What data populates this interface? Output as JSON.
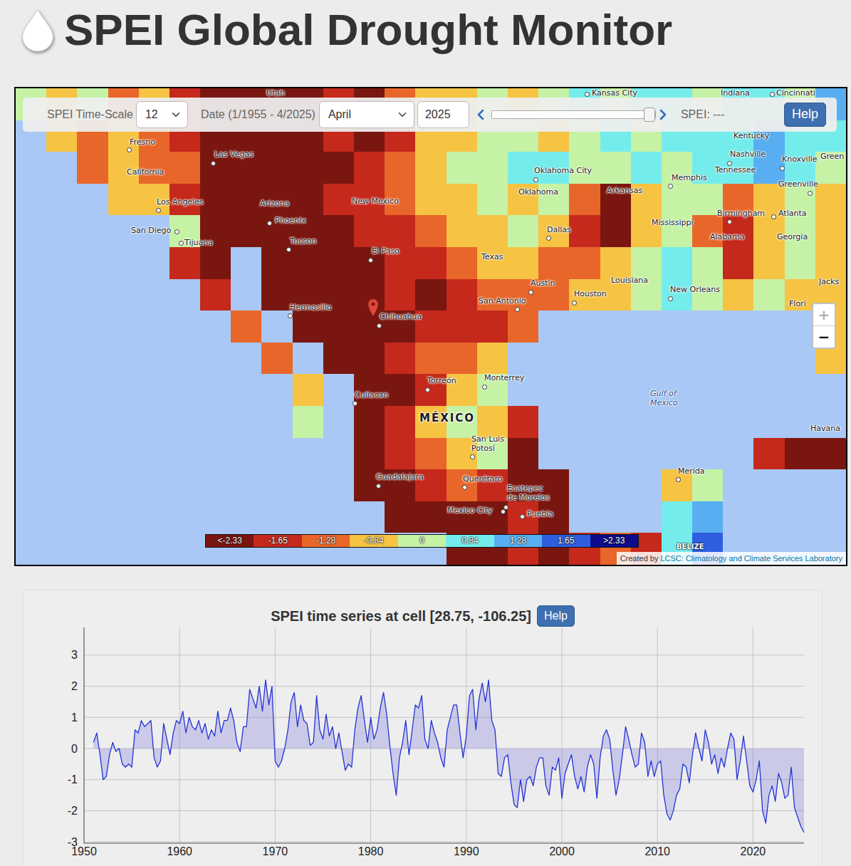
{
  "header": {
    "title": "SPEI Global Drought Monitor"
  },
  "controls": {
    "timescale_label": "SPEI Time-Scale",
    "timescale_value": "12",
    "date_label": "Date (1/1955 - 4/2025)",
    "month_value": "April",
    "year_value": "2025",
    "slider": {
      "level": 1
    },
    "spei_reading": "SPEI: ---",
    "help": "Help"
  },
  "map": {
    "grid": [
      [
        4,
        3,
        4,
        2,
        3,
        1,
        0,
        0,
        0,
        0,
        1,
        0,
        2,
        3,
        3,
        4,
        3,
        4,
        5,
        4,
        5,
        5,
        4,
        5,
        5,
        4,
        6
      ],
      [
        -1,
        3,
        2,
        3,
        2,
        1,
        0,
        0,
        0,
        0,
        1,
        0,
        1,
        3,
        3,
        4,
        4,
        3,
        4,
        5,
        4,
        5,
        5,
        5,
        6,
        5,
        5
      ],
      [
        -1,
        -1,
        2,
        3,
        2,
        2,
        0,
        0,
        0,
        0,
        0,
        1,
        2,
        3,
        4,
        4,
        5,
        5,
        4,
        4,
        5,
        4,
        5,
        5,
        6,
        5,
        4
      ],
      [
        -1,
        -1,
        -1,
        3,
        3,
        1,
        0,
        0,
        0,
        0,
        1,
        1,
        2,
        3,
        3,
        4,
        3,
        4,
        2,
        0,
        3,
        4,
        4,
        2,
        3,
        4,
        3
      ],
      [
        -1,
        -1,
        -1,
        -1,
        -1,
        4,
        0,
        0,
        0,
        0,
        0,
        1,
        1,
        2,
        3,
        3,
        4,
        3,
        1,
        0,
        3,
        4,
        2,
        1,
        3,
        4,
        3
      ],
      [
        -1,
        -1,
        -1,
        -1,
        -1,
        1,
        0,
        -1,
        0,
        0,
        0,
        0,
        1,
        1,
        2,
        3,
        3,
        2,
        2,
        3,
        4,
        5,
        4,
        1,
        3,
        4,
        3
      ],
      [
        -1,
        -1,
        -1,
        -1,
        -1,
        -1,
        1,
        -1,
        0,
        0,
        0,
        0,
        1,
        0,
        1,
        2,
        2,
        2,
        3,
        3,
        4,
        5,
        4,
        3,
        4,
        3,
        3
      ],
      [
        -1,
        -1,
        -1,
        -1,
        -1,
        -1,
        -1,
        2,
        -1,
        0,
        0,
        0,
        0,
        1,
        1,
        1,
        2,
        -1,
        -1,
        -1,
        -1,
        -1,
        -1,
        -1,
        -1,
        -1,
        3
      ],
      [
        -1,
        -1,
        -1,
        -1,
        -1,
        -1,
        -1,
        -1,
        2,
        -1,
        0,
        0,
        1,
        2,
        2,
        3,
        -1,
        -1,
        -1,
        -1,
        -1,
        -1,
        -1,
        -1,
        -1,
        -1,
        3
      ],
      [
        -1,
        -1,
        -1,
        -1,
        -1,
        -1,
        -1,
        -1,
        -1,
        3,
        -1,
        0,
        0,
        1,
        3,
        4,
        -1,
        -1,
        -1,
        -1,
        -1,
        -1,
        -1,
        -1,
        -1,
        -1,
        -1
      ],
      [
        -1,
        -1,
        -1,
        -1,
        -1,
        -1,
        -1,
        -1,
        -1,
        4,
        -1,
        0,
        1,
        3,
        4,
        3,
        1,
        -1,
        -1,
        -1,
        -1,
        -1,
        -1,
        -1,
        -1,
        -1,
        -1
      ],
      [
        -1,
        -1,
        -1,
        -1,
        -1,
        -1,
        -1,
        -1,
        -1,
        -1,
        -1,
        0,
        1,
        2,
        3,
        4,
        0,
        -1,
        -1,
        -1,
        -1,
        -1,
        -1,
        -1,
        1,
        0,
        0
      ],
      [
        -1,
        -1,
        -1,
        -1,
        -1,
        -1,
        -1,
        -1,
        -1,
        -1,
        -1,
        0,
        0,
        1,
        2,
        1,
        0,
        0,
        -1,
        -1,
        -1,
        3,
        4,
        -1,
        -1,
        -1,
        -1
      ],
      [
        -1,
        -1,
        -1,
        -1,
        -1,
        -1,
        -1,
        -1,
        -1,
        -1,
        -1,
        -1,
        0,
        0,
        0,
        0,
        1,
        0,
        -1,
        -1,
        -1,
        5,
        6,
        -1,
        -1,
        -1,
        -1
      ],
      [
        -1,
        -1,
        -1,
        -1,
        -1,
        -1,
        -1,
        -1,
        -1,
        -1,
        -1,
        -1,
        -1,
        -1,
        0,
        0,
        1,
        0,
        1,
        2,
        1,
        5,
        7,
        -1,
        -1,
        -1,
        -1
      ]
    ],
    "labels": [
      {
        "text": "Utah",
        "kind": "region"
      },
      {
        "text": "Kansas City",
        "kind": "city"
      },
      {
        "text": "Indiana",
        "kind": "region"
      },
      {
        "text": "Cincinnati",
        "kind": "city"
      },
      {
        "text": "Kentucky",
        "kind": "region"
      },
      {
        "text": "Fresno",
        "kind": "city"
      },
      {
        "text": "Las Vegas",
        "kind": "city"
      },
      {
        "text": "California",
        "kind": "region"
      },
      {
        "text": "Los Angeles",
        "kind": "city"
      },
      {
        "text": "San Diego",
        "kind": "city"
      },
      {
        "text": "Tijuana",
        "kind": "city"
      },
      {
        "text": "Arizona",
        "kind": "region"
      },
      {
        "text": "Phoenix",
        "kind": "city"
      },
      {
        "text": "Tucson",
        "kind": "city"
      },
      {
        "text": "New Mexico",
        "kind": "region"
      },
      {
        "text": "El Paso",
        "kind": "city"
      },
      {
        "text": "Hermosillo",
        "kind": "city"
      },
      {
        "text": "Chihuahua",
        "kind": "city"
      },
      {
        "text": "Culiacan",
        "kind": "city"
      },
      {
        "text": "Torreón",
        "kind": "city"
      },
      {
        "text": "Monterrey",
        "kind": "city"
      },
      {
        "text": "MÉXICO",
        "kind": "country"
      },
      {
        "text": "San Luis\nPotosí",
        "kind": "city"
      },
      {
        "text": "Guadalajara",
        "kind": "city"
      },
      {
        "text": "Querétaro",
        "kind": "city"
      },
      {
        "text": "Ecatepec\nde Morelos",
        "kind": "city"
      },
      {
        "text": "Mexico City",
        "kind": "city"
      },
      {
        "text": "Puebla",
        "kind": "city"
      },
      {
        "text": "Oklahoma City",
        "kind": "city"
      },
      {
        "text": "Oklahoma",
        "kind": "region"
      },
      {
        "text": "Arkansas",
        "kind": "region"
      },
      {
        "text": "Dallas",
        "kind": "city"
      },
      {
        "text": "Texas",
        "kind": "region"
      },
      {
        "text": "Austin",
        "kind": "city"
      },
      {
        "text": "San Antonio",
        "kind": "city"
      },
      {
        "text": "Houston",
        "kind": "city"
      },
      {
        "text": "Louisiana",
        "kind": "region"
      },
      {
        "text": "New Orleans",
        "kind": "city"
      },
      {
        "text": "Mississippi",
        "kind": "region"
      },
      {
        "text": "Memphis",
        "kind": "city"
      },
      {
        "text": "Tennessee",
        "kind": "region"
      },
      {
        "text": "Nashville",
        "kind": "city"
      },
      {
        "text": "Knoxville",
        "kind": "city"
      },
      {
        "text": "Green",
        "kind": "region"
      },
      {
        "text": "Greenville",
        "kind": "city"
      },
      {
        "text": "Birmingham",
        "kind": "city"
      },
      {
        "text": "Atlanta",
        "kind": "city"
      },
      {
        "text": "Alabama",
        "kind": "region"
      },
      {
        "text": "Georgia",
        "kind": "region"
      },
      {
        "text": "Jacks",
        "kind": "region"
      },
      {
        "text": "Flori",
        "kind": "region"
      },
      {
        "text": "Gulf of\nMexico",
        "kind": "water"
      },
      {
        "text": "Havana",
        "kind": "region"
      },
      {
        "text": "Merida",
        "kind": "city"
      },
      {
        "text": "BELIZE",
        "kind": "nation"
      }
    ],
    "legend": [
      "<-2.33",
      "-1.65",
      "-1.28",
      "-0.84",
      "0",
      "0.84",
      "1.28",
      "1.65",
      ">2.33"
    ],
    "zoom": [
      {
        "label": "+",
        "disabled": true
      },
      {
        "label": "−",
        "disabled": false
      }
    ],
    "attribution": {
      "prefix": "Created by",
      "link": "LCSC: Climatology and Climate Services Laboratory"
    }
  },
  "chart": {
    "title": "SPEI time series at cell [28.75, -106.25]",
    "help": "Help",
    "y_ticks": [
      "3",
      "2",
      "1",
      "0",
      "-1",
      "-2",
      "-3"
    ],
    "x_ticks": [
      "1950",
      "1960",
      "1970",
      "1980",
      "1990",
      "2000",
      "2010",
      "2020"
    ],
    "series": [
      0.2,
      0.5,
      -0.2,
      -1.0,
      -0.9,
      -0.2,
      0.2,
      -0.1,
      0.0,
      -0.5,
      -0.6,
      -0.5,
      -0.6,
      0.6,
      0.5,
      0.9,
      0.7,
      0.8,
      0.9,
      -0.3,
      -0.6,
      -0.4,
      0.8,
      0.3,
      -0.2,
      0.5,
      0.9,
      0.8,
      1.2,
      0.5,
      1.0,
      0.7,
      0.6,
      0.9,
      0.5,
      0.8,
      0.3,
      0.6,
      0.4,
      1.2,
      0.5,
      0.9,
      0.9,
      1.3,
      0.9,
      0.2,
      -0.1,
      0.7,
      0.7,
      1.9,
      1.6,
      1.3,
      2.0,
      1.2,
      2.2,
      1.4,
      2.0,
      -0.4,
      -0.6,
      -0.4,
      0.0,
      0.6,
      1.5,
      1.8,
      0.7,
      1.4,
      0.9,
      0.8,
      0.1,
      0.2,
      1.7,
      0.6,
      0.3,
      1.1,
      0.4,
      0.7,
      0.0,
      0.5,
      -0.1,
      -0.7,
      -0.5,
      -0.6,
      0.6,
      1.3,
      1.7,
      0.9,
      0.2,
      1.0,
      0.3,
      0.6,
      1.3,
      1.8,
      1.1,
      0.1,
      -0.8,
      -1.5,
      -0.3,
      0.2,
      0.9,
      -0.2,
      0.6,
      1.4,
      1.3,
      1.7,
      0.3,
      0.0,
      0.9,
      0.5,
      0.2,
      -0.3,
      -0.6,
      0.6,
      1.0,
      1.4,
      1.4,
      0.5,
      -0.3,
      0.4,
      1.7,
      1.9,
      0.6,
      1.6,
      2.1,
      1.5,
      2.2,
      0.9,
      0.6,
      -0.8,
      -0.9,
      -0.3,
      -0.2,
      -1.1,
      -1.8,
      -1.9,
      -1.0,
      -1.7,
      -1.0,
      -0.9,
      -1.2,
      -0.6,
      -0.3,
      -0.3,
      -1.2,
      -1.5,
      -0.6,
      -0.7,
      -0.3,
      -1.6,
      -0.8,
      -0.5,
      -0.2,
      -0.9,
      -1.3,
      -0.9,
      -1.4,
      -0.6,
      -0.2,
      -0.5,
      -1.6,
      -0.3,
      0.4,
      0.6,
      0.3,
      -0.7,
      -1.5,
      -1.0,
      -0.2,
      0.7,
      0.3,
      -0.2,
      -0.6,
      -0.5,
      0.5,
      0.2,
      -0.9,
      -0.4,
      -0.9,
      -0.5,
      -0.4,
      -1.5,
      -2.1,
      -2.3,
      -2.0,
      -1.5,
      -1.3,
      -0.5,
      -0.6,
      -1.1,
      -0.2,
      0.5,
      0.0,
      -0.4,
      0.6,
      0.2,
      -0.5,
      -0.2,
      -0.8,
      -0.3,
      -0.6,
      0.0,
      0.5,
      0.3,
      -1.0,
      -0.4,
      0.4,
      -0.4,
      -1.2,
      -1.4,
      -1.0,
      -0.4,
      -2.0,
      -2.4,
      -1.5,
      -1.2,
      -1.7,
      -0.8,
      -1.1,
      -1.6,
      -1.5,
      -0.6,
      -1.9,
      -2.2,
      -2.5,
      -2.7
    ]
  }
}
